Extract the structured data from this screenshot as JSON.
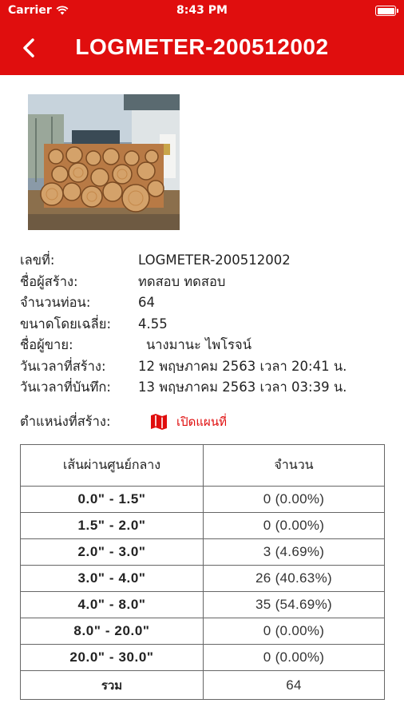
{
  "status_bar": {
    "carrier": "Carrier",
    "time": "8:43 PM"
  },
  "nav": {
    "title": "LOGMETER-200512002",
    "back_icon": "chevron-left-icon"
  },
  "photo": {
    "description_icon": "log-pile-photo"
  },
  "info": {
    "doc_no": {
      "label": "เลขที่:",
      "value": "LOGMETER-200512002"
    },
    "creator": {
      "label": "ชื่อผู้สร้าง:",
      "value": "ทดสอบ ทดสอบ"
    },
    "log_count": {
      "label": "จำนวนท่อน:",
      "value": "64"
    },
    "avg_size": {
      "label": "ขนาดโดยเฉลี่ย:",
      "value": "4.55"
    },
    "seller": {
      "label": "ชื่อผู้ขาย:",
      "value": "นางมานะ ไพโรจน์"
    },
    "created_at": {
      "label": "วันเวลาที่สร้าง:",
      "value": "12 พฤษภาคม 2563 เวลา 20:41 น."
    },
    "saved_at": {
      "label": "วันเวลาที่บันทึก:",
      "value": "13 พฤษภาคม 2563 เวลา 03:39 น."
    }
  },
  "location": {
    "label": "ตำแหน่งที่สร้าง:",
    "link_label": "เปิดแผนที่",
    "icon": "map-icon",
    "accent": "#e00e0e"
  },
  "table": {
    "headers": [
      "เส้นผ่านศูนย์กลาง",
      "จำนวน"
    ],
    "rows": [
      {
        "range": "0.0\" - 1.5\"",
        "count": "0 (0.00%)"
      },
      {
        "range": "1.5\" - 2.0\"",
        "count": "0 (0.00%)"
      },
      {
        "range": "2.0\" - 3.0\"",
        "count": "3 (4.69%)"
      },
      {
        "range": "3.0\" - 4.0\"",
        "count": "26 (40.63%)"
      },
      {
        "range": "4.0\" - 8.0\"",
        "count": "35 (54.69%)"
      },
      {
        "range": "8.0\" - 20.0\"",
        "count": "0 (0.00%)"
      },
      {
        "range": "20.0\" - 30.0\"",
        "count": "0 (0.00%)"
      }
    ],
    "total_label": "รวม",
    "total_value": "64"
  },
  "colors": {
    "brand": "#e00e0e"
  }
}
